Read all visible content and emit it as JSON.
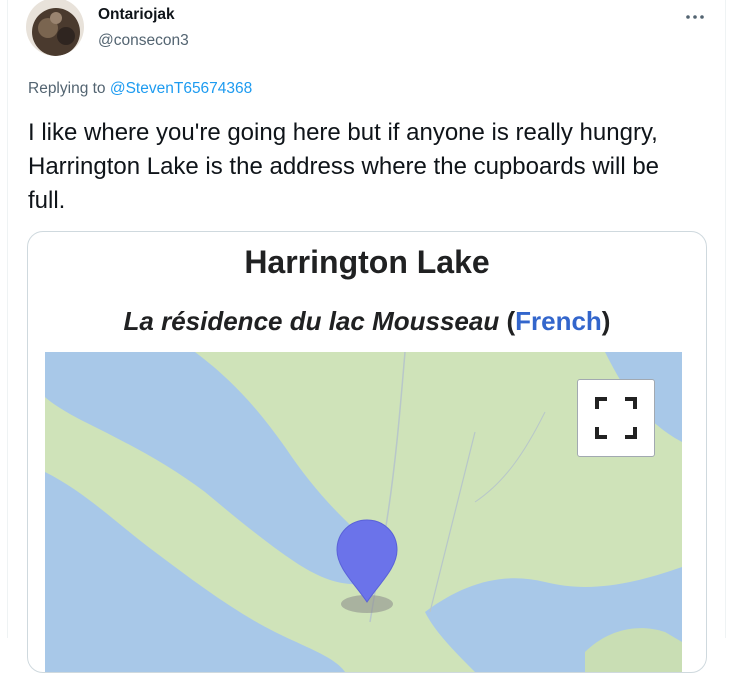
{
  "tweet": {
    "author": {
      "display_name": "Ontariojak",
      "handle": "@consecon3"
    },
    "replying_to": {
      "prefix": "Replying to",
      "handle": "@StevenT65674368"
    },
    "text": "I like where you're going here but if anyone is really hungry, Harrington Lake is the address where the cupboards will be full.",
    "more_icon": "more-horizontal-icon"
  },
  "card": {
    "title": "Harrington Lake",
    "subtitle_italic": "La résidence du lac Mousseau",
    "subtitle_paren_open": " (",
    "subtitle_lang": "French",
    "subtitle_paren_close": ")",
    "map": {
      "fullscreen_icon": "fullscreen-icon",
      "marker_icon": "map-marker-icon",
      "colors": {
        "land": "#cfe3b9",
        "water": "#a8c8e8",
        "marker": "#6b73ea",
        "road": "#b8c7c9"
      }
    }
  }
}
